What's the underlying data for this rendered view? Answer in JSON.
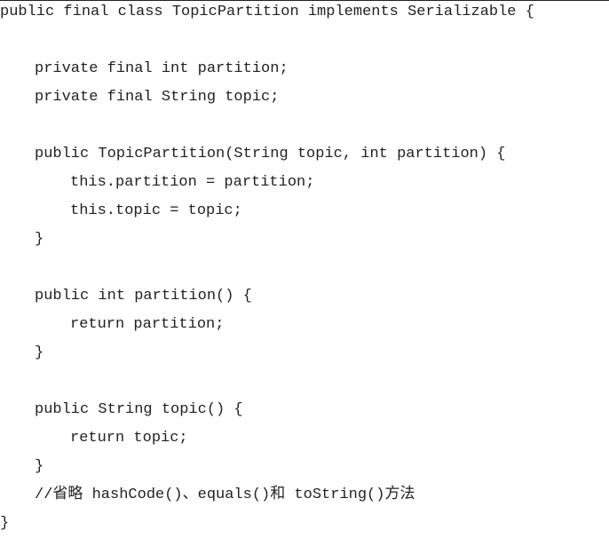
{
  "code": {
    "lines": [
      "public final class TopicPartition implements Serializable {",
      "",
      "private final int partition;",
      "private final String topic;",
      "",
      "public TopicPartition(String topic, int partition) {",
      "this.partition = partition;",
      "this.topic = topic;",
      "}",
      "",
      "public int partition() {",
      "return partition;",
      "}",
      "",
      "public String topic() {",
      "return topic;",
      "}",
      "//省略 hashCode()、equals()和 toString()方法",
      "}"
    ]
  }
}
